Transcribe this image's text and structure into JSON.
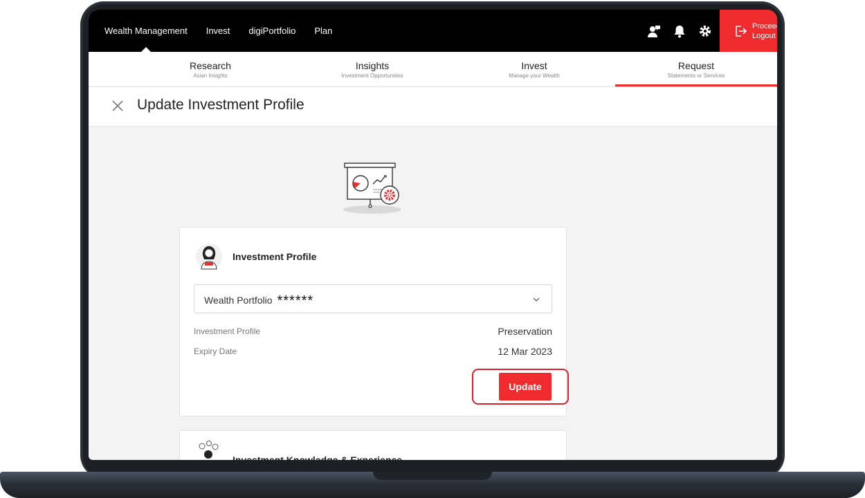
{
  "topnav": {
    "links": [
      "Wealth Management",
      "Invest",
      "digiPortfolio",
      "Plan"
    ],
    "icons": [
      "chat-agent-icon",
      "bell-icon",
      "gear-icon"
    ],
    "logout_line1": "Proceed",
    "logout_line2": "Logout"
  },
  "subnav": [
    {
      "title": "Research",
      "caption": "Asian Insights"
    },
    {
      "title": "Insights",
      "caption": "Investment Opportunities"
    },
    {
      "title": "Invest",
      "caption": "Manage your Wealth"
    },
    {
      "title": "Request",
      "caption": "Statements or Services"
    }
  ],
  "page": {
    "title": "Update Investment Profile"
  },
  "card": {
    "title": "Investment Profile",
    "select_label": "Wealth Portfolio",
    "select_mask": "******",
    "rows": [
      {
        "label": "Investment Profile",
        "value": "Preservation"
      },
      {
        "label": "Expiry Date",
        "value": "12 Mar 2023"
      }
    ],
    "button": "Update"
  },
  "card2": {
    "title": "Investment Knowledge & Experience"
  },
  "colors": {
    "accent": "#ef2b2d",
    "nav_bg": "#000000",
    "page_bg": "#f3f3f3"
  }
}
